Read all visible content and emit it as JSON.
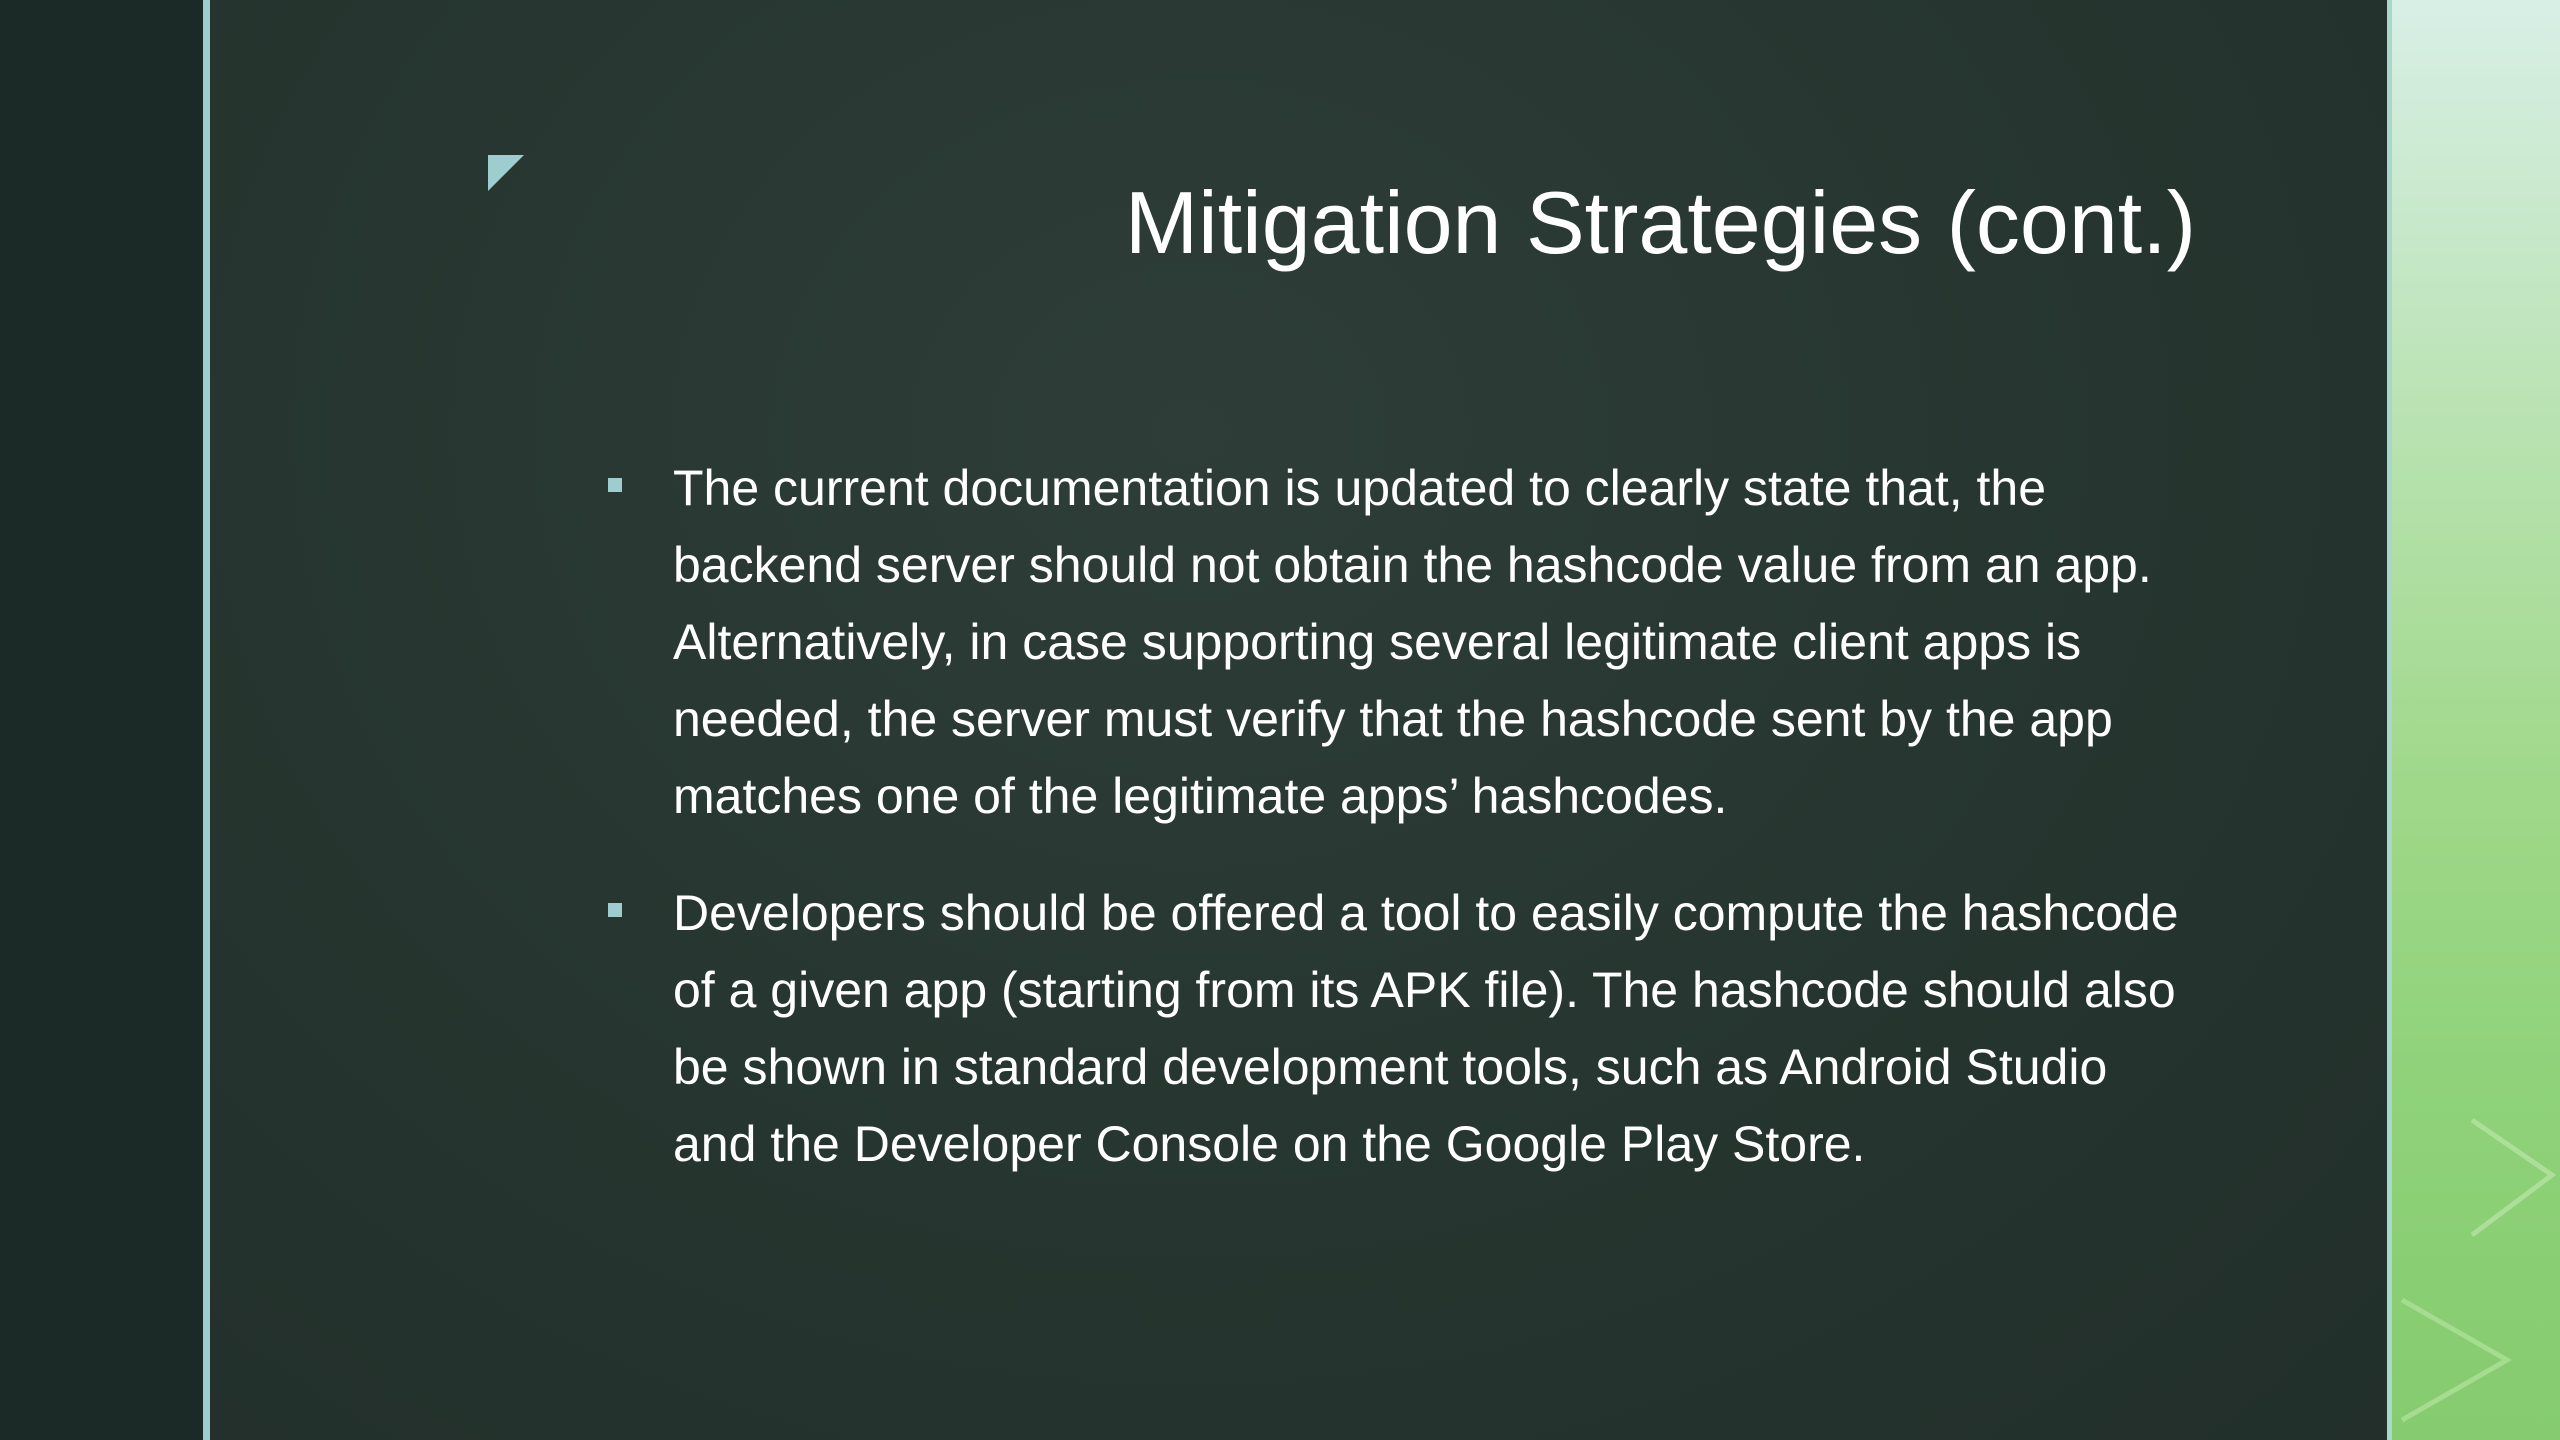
{
  "slide": {
    "title": "Mitigation Strategies (cont.)",
    "bullets": [
      "The current documentation is updated to clearly state that, the backend server should not obtain the hashcode value from an app. Alternatively, in case supporting several legitimate client apps is needed, the server must verify that the hashcode sent by the app matches one of the legitimate apps’ hashcodes.",
      "Developers should be offered a tool to easily compute the hashcode of a given app (starting from its APK file). The hashcode should also be shown in standard development tools, such as Android Studio and the Developer Console on the Google Play Store."
    ]
  },
  "colors": {
    "background": "#26352f",
    "left_band": "#1b2a26",
    "accent": "#9ecdd0",
    "text": "#ffffff",
    "right_panel": "#9fd889"
  },
  "icons": {
    "corner_marker": "triangle-corner-icon",
    "bullet": "square-bullet-icon"
  }
}
